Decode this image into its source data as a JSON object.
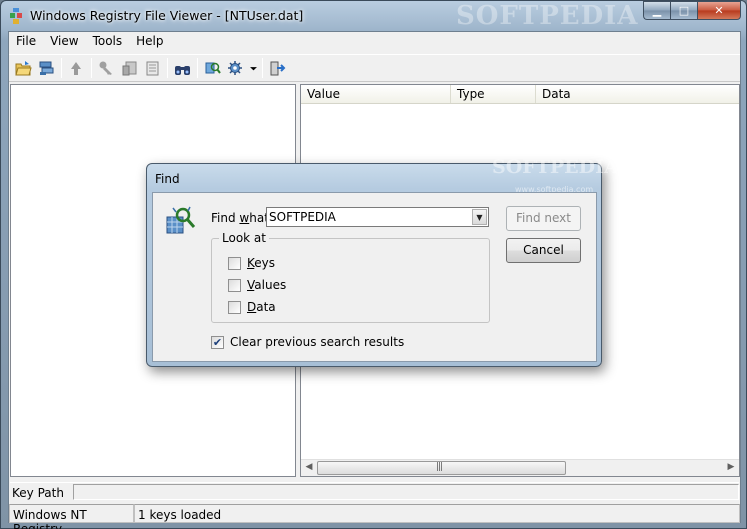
{
  "window": {
    "title": "Windows Registry File Viewer - [NTUser.dat]",
    "watermark": "SOFTPEDIA",
    "minimize": "▁",
    "maximize": "□",
    "close": "✕"
  },
  "menu": [
    "File",
    "View",
    "Tools",
    "Help"
  ],
  "toolbar": {
    "icons": [
      "open-folder-icon",
      "open-registry-icon",
      "up-icon",
      "key-icon",
      "export-icon",
      "properties-icon",
      "find-icon",
      "find-key-icon",
      "settings-icon",
      "dropdown-arrow-icon",
      "exit-icon"
    ]
  },
  "list": {
    "columns": [
      "Value",
      "Type",
      "Data"
    ]
  },
  "keypath": {
    "label": "Key Path",
    "value": ""
  },
  "status": {
    "left": "Windows NT Registry",
    "right": "1 keys loaded"
  },
  "find_dialog": {
    "title": "Find",
    "watermark": "SOFTPEDIA",
    "watermark_url": "www.softpedia.com",
    "find_what_pre": "Find ",
    "find_what_access": "w",
    "find_what_post": "hat:",
    "find_what_value": "SOFTPEDIA",
    "find_next": "Find next",
    "cancel": "Cancel",
    "look_at": "Look at",
    "keys_access": "K",
    "keys_rest": "eys",
    "values_access": "V",
    "values_rest": "alues",
    "data_access": "D",
    "data_rest": "ata",
    "keys_checked": false,
    "values_checked": false,
    "data_checked": false,
    "clear_label": "Clear previous search results",
    "clear_checked": true,
    "check_glyph": "✔"
  },
  "colors": {
    "title_gradient_top": "#b9cde0",
    "close_button": "#c9583e",
    "client_bg": "#f0f0f0"
  }
}
